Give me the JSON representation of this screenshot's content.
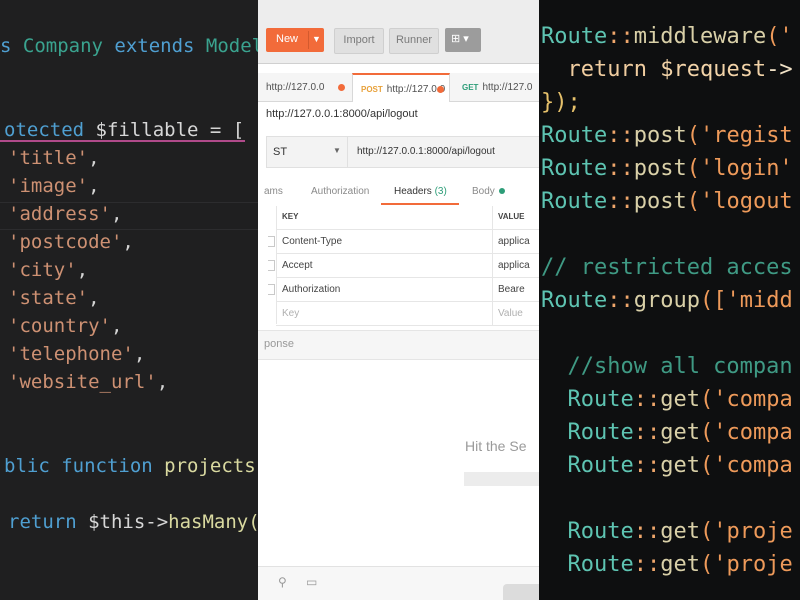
{
  "left_code": {
    "lines": [
      {
        "parts": [
          {
            "t": "s ",
            "c": "kw"
          },
          {
            "t": "Company",
            "c": "cls"
          },
          {
            "t": " extends ",
            "c": "kw"
          },
          {
            "t": "Model",
            "c": "cls"
          }
        ]
      },
      {
        "parts": [
          {
            "t": "otected ",
            "c": "kw"
          },
          {
            "t": "$fillable",
            "c": "var"
          },
          {
            "t": " = [",
            "c": "pun"
          }
        ]
      },
      {
        "parts": [
          {
            "t": "'title'",
            "c": "str"
          },
          {
            "t": ",",
            "c": "pun"
          }
        ]
      },
      {
        "parts": [
          {
            "t": "'image'",
            "c": "str"
          },
          {
            "t": ",",
            "c": "pun"
          }
        ]
      },
      {
        "parts": [
          {
            "t": "'address'",
            "c": "str"
          },
          {
            "t": ",",
            "c": "pun"
          }
        ]
      },
      {
        "parts": [
          {
            "t": "'postcode'",
            "c": "str"
          },
          {
            "t": ",",
            "c": "pun"
          }
        ]
      },
      {
        "parts": [
          {
            "t": "'city'",
            "c": "str"
          },
          {
            "t": ",",
            "c": "pun"
          }
        ]
      },
      {
        "parts": [
          {
            "t": "'state'",
            "c": "str"
          },
          {
            "t": ",",
            "c": "pun"
          }
        ]
      },
      {
        "parts": [
          {
            "t": "'country'",
            "c": "str"
          },
          {
            "t": ",",
            "c": "pun"
          }
        ]
      },
      {
        "parts": [
          {
            "t": "'telephone'",
            "c": "str"
          },
          {
            "t": ",",
            "c": "pun"
          }
        ]
      },
      {
        "parts": [
          {
            "t": "'website_url'",
            "c": "str"
          },
          {
            "t": ",",
            "c": "pun"
          }
        ]
      },
      {
        "parts": [
          {
            "t": "blic ",
            "c": "kw"
          },
          {
            "t": "function",
            "c": "kw"
          },
          {
            "t": " projects(",
            "c": "fn"
          }
        ]
      },
      {
        "parts": [
          {
            "t": "return ",
            "c": "kw"
          },
          {
            "t": "$this",
            "c": "var"
          },
          {
            "t": "->",
            "c": "pun"
          },
          {
            "t": "hasMany(F",
            "c": "fn"
          }
        ]
      }
    ]
  },
  "postman": {
    "toolbar": {
      "new_label": "New",
      "import_label": "Import",
      "runner_label": "Runner"
    },
    "tabs": [
      {
        "method": "",
        "label": "http://127.0.0",
        "unsaved": true
      },
      {
        "method": "POST",
        "label": "http://127.0.0",
        "unsaved": true
      },
      {
        "method": "GET",
        "label": "http://127.0",
        "unsaved": false
      }
    ],
    "request_title": "http://127.0.0.1:8000/api/logout",
    "method": "ST",
    "url": "http://127.0.0.1:8000/api/logout",
    "sub_tabs": {
      "params": "ams",
      "auth": "Authorization",
      "headers": "Headers",
      "headers_count": "(3)",
      "body": "Body"
    },
    "headers_table": {
      "col_key": "KEY",
      "col_value": "VALUE",
      "rows": [
        {
          "key": "Content-Type",
          "value": "applica"
        },
        {
          "key": "Accept",
          "value": "applica"
        },
        {
          "key": "Authorization",
          "value": "Beare"
        }
      ],
      "placeholder_key": "Key",
      "placeholder_value": "Value"
    },
    "response_label": "ponse",
    "hit_send": "Hit the Se",
    "colors": {
      "accent": "#f26b3a",
      "green": "#2d9d78"
    }
  },
  "routes_code": {
    "lines": [
      {
        "parts": [
          {
            "t": "Route",
            "c": "r-cls"
          },
          {
            "t": "::",
            "c": "r-op"
          },
          {
            "t": "middleware",
            "c": "r-fn"
          },
          {
            "t": "('",
            "c": "r-str"
          }
        ]
      },
      {
        "parts": [
          {
            "t": "  return ",
            "c": "r-kw"
          },
          {
            "t": "$request",
            "c": "r-var"
          },
          {
            "t": "->",
            "c": "r-white"
          }
        ]
      },
      {
        "parts": [
          {
            "t": "});",
            "c": "r-pun"
          }
        ]
      },
      {
        "parts": [
          {
            "t": "Route",
            "c": "r-cls"
          },
          {
            "t": "::",
            "c": "r-op"
          },
          {
            "t": "post",
            "c": "r-fn"
          },
          {
            "t": "('regist",
            "c": "r-str"
          }
        ]
      },
      {
        "parts": [
          {
            "t": "Route",
            "c": "r-cls"
          },
          {
            "t": "::",
            "c": "r-op"
          },
          {
            "t": "post",
            "c": "r-fn"
          },
          {
            "t": "('login'",
            "c": "r-str"
          }
        ]
      },
      {
        "parts": [
          {
            "t": "Route",
            "c": "r-cls"
          },
          {
            "t": "::",
            "c": "r-op"
          },
          {
            "t": "post",
            "c": "r-fn"
          },
          {
            "t": "('logout",
            "c": "r-str"
          }
        ]
      },
      {
        "parts": [
          {
            "t": "// restricted acces",
            "c": "r-cmt"
          }
        ]
      },
      {
        "parts": [
          {
            "t": "Route",
            "c": "r-cls"
          },
          {
            "t": "::",
            "c": "r-op"
          },
          {
            "t": "group",
            "c": "r-fn"
          },
          {
            "t": "(['midd",
            "c": "r-str"
          }
        ]
      },
      {
        "parts": [
          {
            "t": "  //show all compan",
            "c": "r-cmt"
          }
        ]
      },
      {
        "parts": [
          {
            "t": "  Route",
            "c": "r-cls"
          },
          {
            "t": "::",
            "c": "r-op"
          },
          {
            "t": "get",
            "c": "r-fn"
          },
          {
            "t": "('compa",
            "c": "r-str"
          }
        ]
      },
      {
        "parts": [
          {
            "t": "  Route",
            "c": "r-cls"
          },
          {
            "t": "::",
            "c": "r-op"
          },
          {
            "t": "get",
            "c": "r-fn"
          },
          {
            "t": "('compa",
            "c": "r-str"
          }
        ]
      },
      {
        "parts": [
          {
            "t": "  Route",
            "c": "r-cls"
          },
          {
            "t": "::",
            "c": "r-op"
          },
          {
            "t": "get",
            "c": "r-fn"
          },
          {
            "t": "('compa",
            "c": "r-str"
          }
        ]
      },
      {
        "parts": [
          {
            "t": "  Route",
            "c": "r-cls"
          },
          {
            "t": "::",
            "c": "r-op"
          },
          {
            "t": "get",
            "c": "r-fn"
          },
          {
            "t": "('proje",
            "c": "r-str"
          }
        ]
      },
      {
        "parts": [
          {
            "t": "  Route",
            "c": "r-cls"
          },
          {
            "t": "::",
            "c": "r-op"
          },
          {
            "t": "get",
            "c": "r-fn"
          },
          {
            "t": "('proje",
            "c": "r-str"
          }
        ]
      }
    ]
  }
}
